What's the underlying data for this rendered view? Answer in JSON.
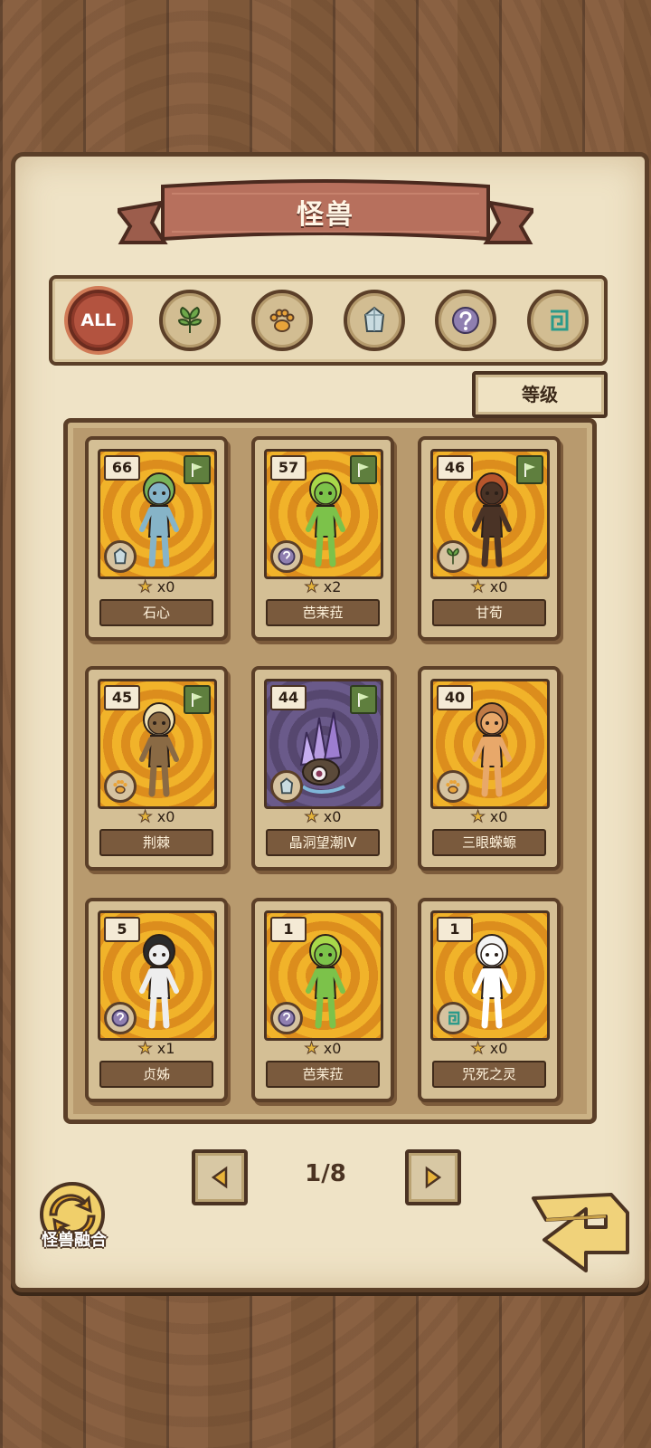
{
  "header": {
    "title": "怪兽"
  },
  "filter_tabs": [
    {
      "name": "all",
      "label": "ALL",
      "icon": "all-icon",
      "active": true
    },
    {
      "name": "plant",
      "label": "",
      "icon": "leaf-icon",
      "active": false
    },
    {
      "name": "beast",
      "label": "",
      "icon": "paw-icon",
      "active": false
    },
    {
      "name": "mineral",
      "label": "",
      "icon": "crystal-icon",
      "active": false
    },
    {
      "name": "unknown",
      "label": "",
      "icon": "question-icon",
      "active": false
    },
    {
      "name": "spirit",
      "label": "",
      "icon": "spiral-icon",
      "active": false
    }
  ],
  "sort": {
    "label": "等级"
  },
  "cards": [
    {
      "level": "66",
      "stars": "x0",
      "name": "石心",
      "type_icon": "crystal-icon",
      "flag": true,
      "hair": "#79b35a",
      "body": "#86b4c8",
      "art": "gold"
    },
    {
      "level": "57",
      "stars": "x2",
      "name": "芭茉菈",
      "type_icon": "question-icon",
      "flag": true,
      "hair": "#a8d84a",
      "body": "#7cc24a",
      "art": "gold"
    },
    {
      "level": "46",
      "stars": "x0",
      "name": "甘荀",
      "type_icon": "leaf-icon",
      "flag": true,
      "hair": "#b7552c",
      "body": "#4a3326",
      "art": "gold"
    },
    {
      "level": "45",
      "stars": "x0",
      "name": "荆棘",
      "type_icon": "paw-icon",
      "flag": true,
      "hair": "#f1e3b4",
      "body": "#8a6a44",
      "art": "gold"
    },
    {
      "level": "44",
      "stars": "x0",
      "name": "晶洞望潮IV",
      "type_icon": "crystal-icon",
      "flag": true,
      "hair": "#a27ed0",
      "body": "#5b4a3a",
      "art": "dark"
    },
    {
      "level": "40",
      "stars": "x0",
      "name": "三眼蝾螈",
      "type_icon": "paw-icon",
      "flag": false,
      "hair": "#c07a45",
      "body": "#e8a86a",
      "art": "gold"
    },
    {
      "level": "5",
      "stars": "x1",
      "name": "贞姊",
      "type_icon": "question-icon",
      "flag": false,
      "hair": "#2b2b2b",
      "body": "#eeeeee",
      "art": "gold"
    },
    {
      "level": "1",
      "stars": "x0",
      "name": "芭茉菈",
      "type_icon": "question-icon",
      "flag": false,
      "hair": "#a8d84a",
      "body": "#7cc24a",
      "art": "gold"
    },
    {
      "level": "1",
      "stars": "x0",
      "name": "咒死之灵",
      "type_icon": "spiral-icon",
      "flag": false,
      "hair": "#f3f3f3",
      "body": "#ffffff",
      "art": "gold"
    }
  ],
  "pagination": {
    "text": "1/8",
    "prev_icon": "arrow-left-icon",
    "next_icon": "arrow-right-icon"
  },
  "fusion": {
    "label": "怪兽融合",
    "icon": "fusion-icon"
  },
  "back": {
    "icon": "return-arrow-icon"
  },
  "colors": {
    "accent": "#b3533f",
    "wood": "#7a5537",
    "paper": "#efe3c6",
    "card_gold": "#f1b32a"
  }
}
